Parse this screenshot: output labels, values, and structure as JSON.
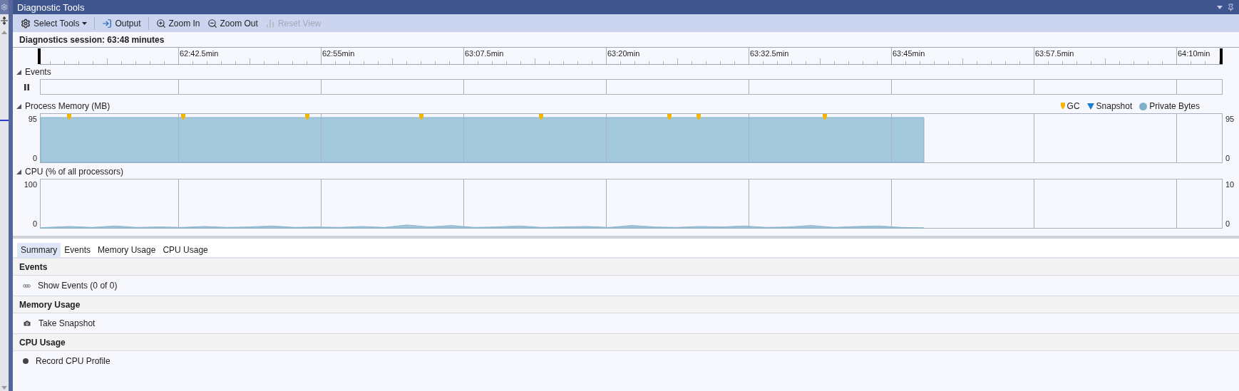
{
  "window": {
    "title": "Diagnostic Tools"
  },
  "toolbar": [
    {
      "label": "Select Tools",
      "kind": "menu",
      "disabled": false
    },
    {
      "label": "Output",
      "kind": "button",
      "disabled": false
    },
    {
      "label": "Zoom In",
      "kind": "button",
      "disabled": false
    },
    {
      "label": "Zoom Out",
      "kind": "button",
      "disabled": false
    },
    {
      "label": "Reset View",
      "kind": "button",
      "disabled": true
    }
  ],
  "session": "Diagnostics session: 63:48 minutes",
  "timeline": {
    "ticks": [
      "62:42.5min",
      "62:55min",
      "63:07.5min",
      "63:20min",
      "63:32.5min",
      "63:45min",
      "63:57.5min",
      "64:10min"
    ]
  },
  "events": {
    "title": "Events",
    "expanded": true
  },
  "memory": {
    "title": "Process Memory (MB)",
    "expanded": true,
    "legend": [
      {
        "kind": "gc",
        "label": "GC",
        "color": "#f5b400"
      },
      {
        "kind": "snapshot",
        "label": "Snapshot",
        "color": "#1c7cd5"
      },
      {
        "kind": "dot",
        "label": "Private Bytes",
        "color": "#7fb0cc"
      }
    ],
    "left_labels": [
      "95",
      "0"
    ],
    "right_labels": [
      "95",
      "0"
    ]
  },
  "cpu": {
    "title": "CPU (% of all processors)",
    "expanded": true,
    "left_labels": [
      "100",
      "0"
    ],
    "right_labels": [
      "10",
      "0"
    ]
  },
  "tabs": [
    {
      "label": "Summary",
      "selected": true
    },
    {
      "label": "Events",
      "selected": false
    },
    {
      "label": "Memory Usage",
      "selected": false
    },
    {
      "label": "CPU Usage",
      "selected": false
    }
  ],
  "summary": [
    {
      "title": "Events",
      "items": [
        "Show Events (0 of 0)"
      ]
    },
    {
      "title": "Memory Usage",
      "items": [
        "Take Snapshot"
      ]
    },
    {
      "title": "CPU Usage",
      "items": [
        "Record CPU Profile"
      ]
    }
  ]
}
